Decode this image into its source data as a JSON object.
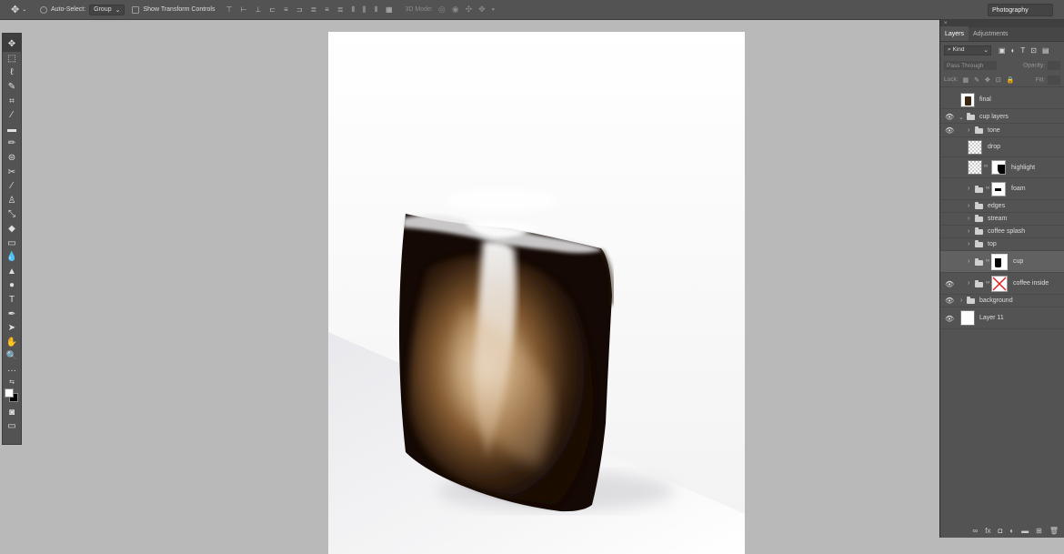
{
  "options_bar": {
    "tool_icon": "move-tool-icon",
    "auto_select_label": "Auto-Select:",
    "auto_select_value": "Group",
    "show_transform_label": "Show Transform Controls",
    "mode_3d_label": "3D Mode:",
    "workspace": "Photography"
  },
  "tools": [
    "move-tool",
    "marquee-tool",
    "lasso-tool",
    "quick-selection-tool",
    "crop-tool",
    "eyedropper-tool",
    "healing-brush-tool",
    "brush-tool",
    "clone-stamp-tool",
    "history-brush-tool",
    "eraser-tool",
    "gradient-tool",
    "blur-tool",
    "dodge-tool",
    "pen-tool",
    "type-tool",
    "path-selection-tool",
    "rectangle-tool",
    "hand-tool",
    "zoom-tool",
    "more-tools"
  ],
  "layers_panel": {
    "tabs": [
      "Layers",
      "Adjustments"
    ],
    "filter_kind": "Kind",
    "blend_mode": "Pass Through",
    "opacity_label": "Opacity:",
    "lock_label": "Lock:",
    "fill_label": "Fill:",
    "layers": [
      {
        "name": "final",
        "visible": false,
        "type": "image"
      },
      {
        "name": "cup layers",
        "visible": true,
        "type": "group-open"
      },
      {
        "name": "tone",
        "visible": true,
        "type": "group"
      },
      {
        "name": "drop",
        "visible": false,
        "type": "pixel"
      },
      {
        "name": "highlight",
        "visible": false,
        "type": "pixel-mask"
      },
      {
        "name": "foam",
        "visible": false,
        "type": "group-mask"
      },
      {
        "name": "edges",
        "visible": false,
        "type": "group"
      },
      {
        "name": "stream",
        "visible": false,
        "type": "group"
      },
      {
        "name": "coffee splash",
        "visible": false,
        "type": "group"
      },
      {
        "name": "top",
        "visible": false,
        "type": "group"
      },
      {
        "name": "cup",
        "visible": false,
        "type": "group-mask",
        "selected": true
      },
      {
        "name": "coffee inside",
        "visible": true,
        "type": "group-mask-disabled"
      },
      {
        "name": "background",
        "visible": true,
        "type": "group"
      },
      {
        "name": "Layer 11",
        "visible": true,
        "type": "fill"
      }
    ],
    "footer_icons": [
      "link-icon",
      "fx-icon",
      "add-mask-icon",
      "adjustment-icon",
      "new-group-icon",
      "new-layer-icon",
      "delete-icon"
    ]
  }
}
